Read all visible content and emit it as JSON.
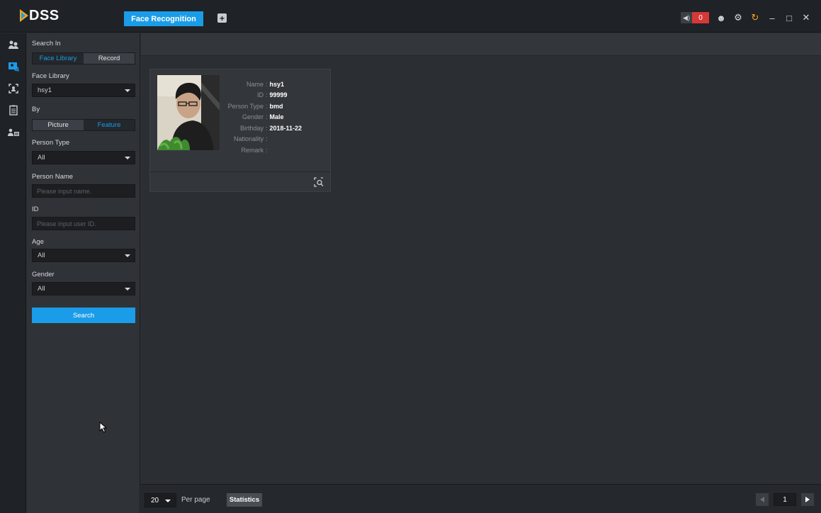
{
  "app": {
    "logo": "DSS",
    "active_tab": "Face Recognition",
    "add_tab_icon": "plus-icon",
    "alarm_count": "0",
    "colors": {
      "accent": "#1a9ce8",
      "alarm": "#d63838",
      "logo_orange": "#f5a623"
    }
  },
  "rail": {
    "items": [
      {
        "icon": "live-view-icon"
      },
      {
        "icon": "face-search-icon",
        "active": true
      },
      {
        "icon": "face-capture-icon"
      },
      {
        "icon": "report-icon"
      },
      {
        "icon": "person-list-icon"
      }
    ]
  },
  "filter": {
    "search_in_label": "Search In",
    "search_in_options": [
      "Face Library",
      "Record"
    ],
    "face_library_label": "Face Library",
    "face_library_value": "hsy1",
    "by_label": "By",
    "by_options": [
      "Picture",
      "Feature"
    ],
    "person_type_label": "Person Type",
    "person_type_value": "All",
    "person_name_label": "Person Name",
    "person_name_placeholder": "Please input name.",
    "id_label": "ID",
    "id_placeholder": "Please input user ID.",
    "age_label": "Age",
    "age_value": "All",
    "gender_label": "Gender",
    "gender_value": "All",
    "search_button": "Search"
  },
  "result_card": {
    "fields": [
      {
        "label": "Name",
        "value": "hsy1"
      },
      {
        "label": "ID",
        "value": "99999"
      },
      {
        "label": "Person Type",
        "value": "bmd"
      },
      {
        "label": "Gender",
        "value": "Male"
      },
      {
        "label": "Birthday",
        "value": "2018-11-22"
      },
      {
        "label": "Nationality",
        "value": ""
      },
      {
        "label": "Remark",
        "value": ""
      }
    ],
    "separator": ":"
  },
  "bottom": {
    "per_page_value": "20",
    "per_page_label": "Per page",
    "statistics_button": "Statistics",
    "current_page": "1"
  }
}
